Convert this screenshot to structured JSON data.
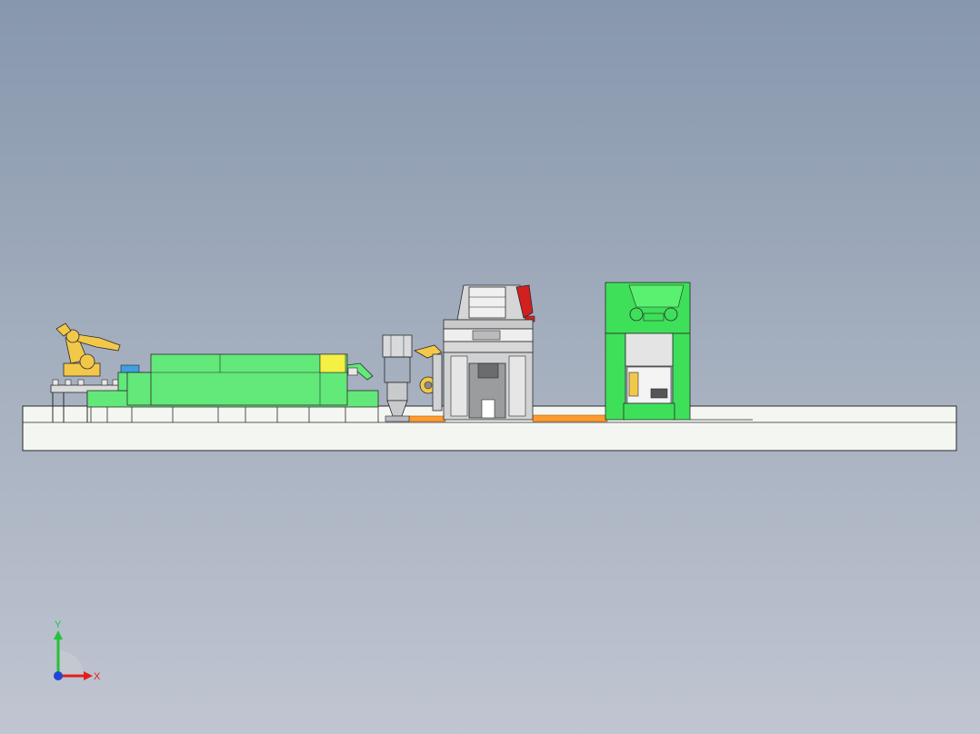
{
  "viewport": {
    "background_top": "#8797ad",
    "background_bottom": "#c0c5d1"
  },
  "colors": {
    "machine_green": "#63e87a",
    "machine_green_dark": "#2fb84a",
    "press_green": "#3ee05a",
    "robot_yellow": "#f2c84a",
    "conveyor_orange": "#ff9b2e",
    "platform": "#f4f6f2",
    "outline": "#2a2a2a",
    "steel_grey": "#b8bcc0",
    "accent_red": "#d21f1f",
    "accent_yellow": "#f4f044"
  },
  "scene": {
    "components": [
      "robot-arm-loader",
      "heating-furnace-line",
      "filter-tower",
      "transfer-robot",
      "forging-hammer",
      "stamping-press"
    ]
  },
  "triad": {
    "y_label": "Y",
    "x_label": "X",
    "y_color": "#23c23a",
    "x_color": "#e02020",
    "origin_color": "#1f46d8"
  }
}
